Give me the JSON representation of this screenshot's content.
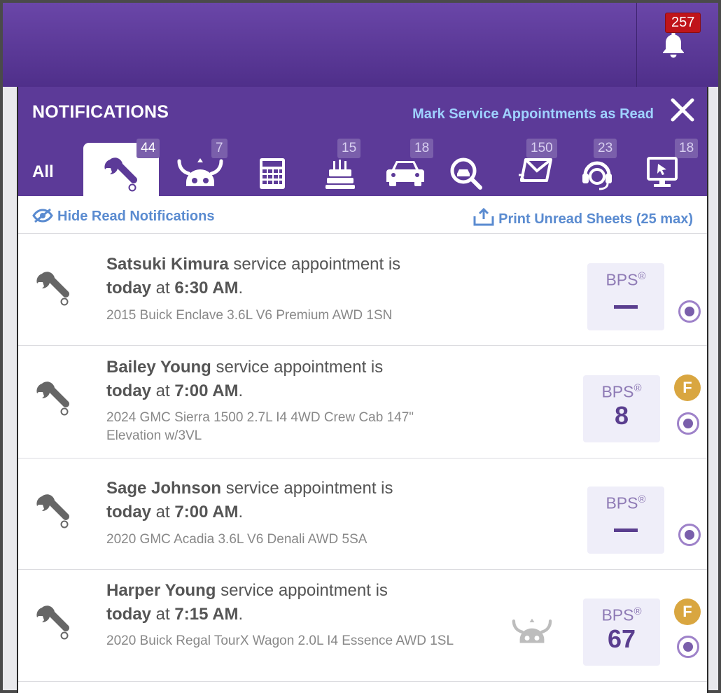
{
  "header": {
    "notification_count": "257"
  },
  "panel": {
    "title": "NOTIFICATIONS",
    "mark_read_label": "Mark Service Appointments as Read"
  },
  "tabs": [
    {
      "label": "All",
      "count": ""
    },
    {
      "icon": "wrench-icon",
      "count": "44"
    },
    {
      "icon": "viking-icon",
      "count": "7"
    },
    {
      "icon": "calculator-icon",
      "count": ""
    },
    {
      "icon": "birthday-cake-icon",
      "count": "15"
    },
    {
      "icon": "car-icon",
      "count": "18"
    },
    {
      "icon": "search-car-icon",
      "count": ""
    },
    {
      "icon": "email-icon",
      "count": "150"
    },
    {
      "icon": "headset-icon",
      "count": "23"
    },
    {
      "icon": "monitor-click-icon",
      "count": "18"
    }
  ],
  "toolbar": {
    "hide_read_label": "Hide Read Notifications",
    "print_label": "Print Unread Sheets (25 max)"
  },
  "notifications": [
    {
      "name": "Satsuki Kimura",
      "text_mid": " service appointment is",
      "day": "today",
      "text_at": " at ",
      "time": "6:30 AM",
      "period": ".",
      "vehicle": "2015 Buick Enclave 3.6L V6 Premium AWD 1SN",
      "bps_label": "BPS",
      "bps_reg": "®",
      "bps_value": "",
      "flag": ""
    },
    {
      "name": "Bailey Young",
      "text_mid": " service appointment is",
      "day": "today",
      "text_at": " at ",
      "time": "7:00 AM",
      "period": ".",
      "vehicle": "2024 GMC Sierra 1500 2.7L I4 4WD Crew Cab 147\" Elevation w/3VL",
      "bps_label": "BPS",
      "bps_reg": "®",
      "bps_value": "8",
      "flag": "F"
    },
    {
      "name": "Sage Johnson",
      "text_mid": " service appointment is",
      "day": "today",
      "text_at": " at ",
      "time": "7:00 AM",
      "period": ".",
      "vehicle": "2020 GMC Acadia 3.6L V6 Denali AWD 5SA",
      "bps_label": "BPS",
      "bps_reg": "®",
      "bps_value": "",
      "flag": ""
    },
    {
      "name": "Harper Young",
      "text_mid": " service appointment is",
      "day": "today",
      "text_at": " at ",
      "time": "7:15 AM",
      "period": ".",
      "vehicle": "2020 Buick Regal TourX Wagon 2.0L I4 Essence AWD 1SL",
      "bps_label": "BPS",
      "bps_reg": "®",
      "bps_value": "67",
      "flag": "F"
    }
  ],
  "colors": {
    "header_purple": "#5c3a98",
    "link_blue": "#5a8bd0",
    "flag_gold": "#d9a640",
    "badge_red": "#c0141a"
  }
}
